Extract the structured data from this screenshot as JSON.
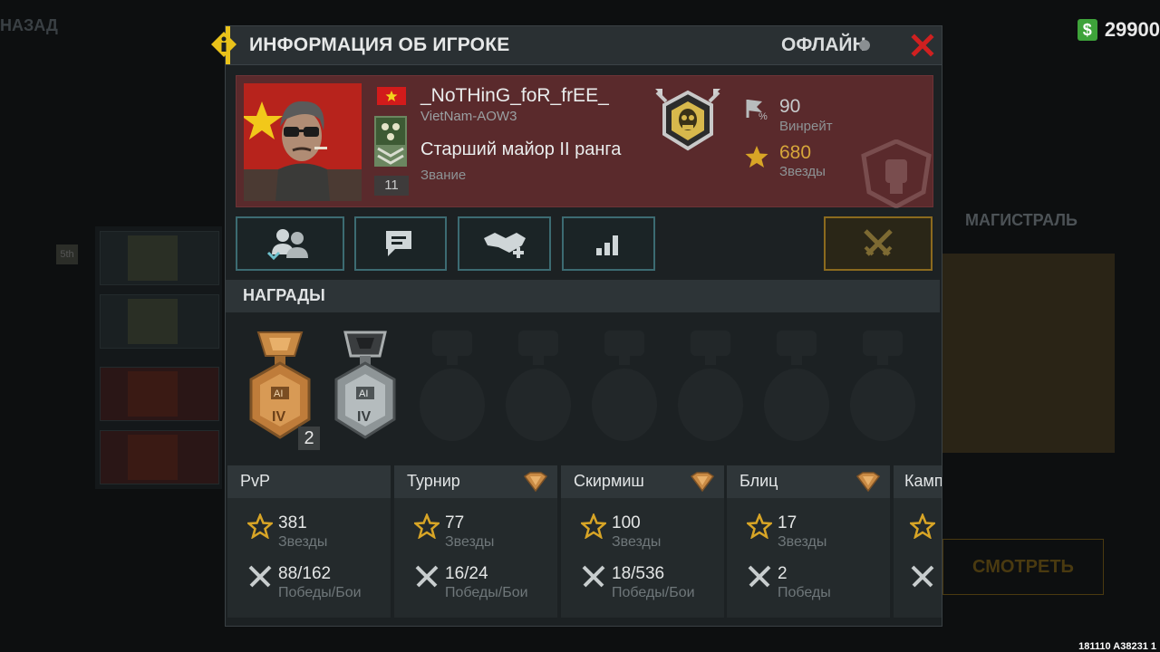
{
  "background": {
    "back_label": "НАЗАД",
    "money": "29900",
    "map_title": "МАГИСТРАЛЬ",
    "watch_label": "СМОТРЕТЬ",
    "build_id": "181110 A38231 1"
  },
  "modal": {
    "title": "ИНФОРМАЦИЯ ОБ ИГРОКЕ",
    "status": "ОФЛАЙН",
    "colors": {
      "accent": "#e9c21a",
      "close": "#d02020",
      "card": "#5a2a2c"
    }
  },
  "player": {
    "name": "_NoTHinG_foR_frEE_",
    "clan": "VietNam-AOW3",
    "rank_title": "Старший майор II ранга",
    "rank_caption": "Звание",
    "rank_level": "11",
    "winrate": "90",
    "winrate_label": "Винрейт",
    "stars": "680",
    "stars_label": "Звезды"
  },
  "awards": {
    "title": "НАГРАДЫ",
    "medals": [
      {
        "tier": "bronze",
        "label": "AI",
        "roman": "IV",
        "count": "2"
      },
      {
        "tier": "silver",
        "label": "AI",
        "roman": "IV"
      }
    ]
  },
  "modes": [
    {
      "title": "PvP",
      "stars": "381",
      "stars_label": "Звезды",
      "record": "88/162",
      "record_label": "Победы/Бои",
      "badge": false
    },
    {
      "title": "Турнир",
      "stars": "77",
      "stars_label": "Звезды",
      "record": "16/24",
      "record_label": "Победы/Бои",
      "badge": true
    },
    {
      "title": "Скирмиш",
      "stars": "100",
      "stars_label": "Звезды",
      "record": "18/536",
      "record_label": "Победы/Бои",
      "badge": true
    },
    {
      "title": "Блиц",
      "stars": "17",
      "stars_label": "Звезды",
      "record": "2",
      "record_label": "Победы",
      "badge": true
    },
    {
      "title": "Камп",
      "stars": "",
      "stars_label": "",
      "record": "",
      "record_label": "",
      "badge": false
    }
  ]
}
